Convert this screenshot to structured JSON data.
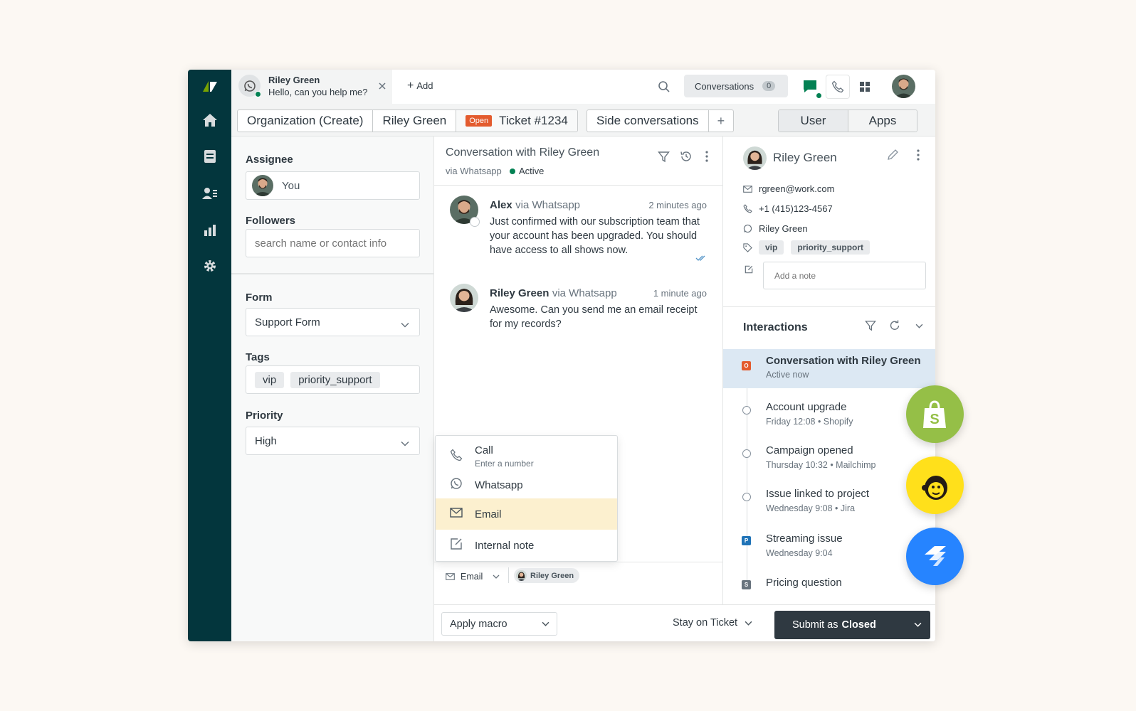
{
  "topbar": {
    "active_tab": {
      "name": "Riley Green",
      "preview": "Hello, can you help me?"
    },
    "add_label": "Add",
    "conversations_label": "Conversations",
    "conversations_count": "0"
  },
  "tabbar": {
    "organization": "Organization (Create)",
    "requester": "Riley Green",
    "status_badge": "Open",
    "ticket": "Ticket #1234",
    "side_conversations": "Side conversations",
    "user": "User",
    "apps": "Apps"
  },
  "properties": {
    "assignee_label": "Assignee",
    "assignee_value": "You",
    "followers_label": "Followers",
    "followers_placeholder": "search name or contact info",
    "form_label": "Form",
    "form_value": "Support Form",
    "tags_label": "Tags",
    "tags": [
      "vip",
      "priority_support"
    ],
    "priority_label": "Priority",
    "priority_value": "High"
  },
  "conversation": {
    "title": "Conversation with Riley Green",
    "via": "via Whatsapp",
    "status": "Active",
    "messages": [
      {
        "author": "Alex",
        "via": "via Whatsapp",
        "time": "2 minutes ago",
        "body": "Just confirmed with our subscription team that your account has been upgraded. You should have access to all shows now."
      },
      {
        "author": "Riley Green",
        "via": "via Whatsapp",
        "time": "1 minute ago",
        "body": "Awesome. Can you send me an email receipt for my records?"
      }
    ],
    "channel_menu": [
      {
        "label": "Call",
        "sub": "Enter a number",
        "icon": "phone-icon"
      },
      {
        "label": "Whatsapp",
        "icon": "whatsapp-icon"
      },
      {
        "label": "Email",
        "icon": "mail-icon",
        "highlighted": true
      },
      {
        "label": "Internal note",
        "icon": "note-icon"
      }
    ],
    "composer": {
      "channel": "Email",
      "recipient": "Riley Green"
    }
  },
  "footer": {
    "apply_macro": "Apply macro",
    "stay_on_ticket": "Stay on Ticket",
    "submit_prefix": "Submit as",
    "submit_status": "Closed"
  },
  "user": {
    "name": "Riley Green",
    "email": "rgreen@work.com",
    "phone": "+1 (415)123-4567",
    "whatsapp": "Riley Green",
    "tags": [
      "vip",
      "priority_support"
    ],
    "note_placeholder": "Add a note"
  },
  "interactions": {
    "title": "Interactions",
    "items": [
      {
        "title": "Conversation with Riley Green",
        "sub": "Active now",
        "marker": "O",
        "marker_color": "#e35b2e",
        "active": true
      },
      {
        "title": "Account upgrade",
        "sub": "Friday 12:08 • Shopify"
      },
      {
        "title": "Campaign opened",
        "sub": "Thursday 10:32 • Mailchimp"
      },
      {
        "title": "Issue linked to project",
        "sub": "Wednesday 9:08 • Jira"
      },
      {
        "title": "Streaming issue",
        "sub": "Wednesday 9:04",
        "marker": "P",
        "marker_color": "#1f73b7"
      },
      {
        "title": "Pricing question",
        "sub": "",
        "marker": "S",
        "marker_color": "#68737d"
      }
    ]
  },
  "colors": {
    "rail": "#03363d",
    "accent_green": "#038153",
    "open_badge": "#e35b2e",
    "highlight": "#fcf0cf",
    "active_row": "#dce8f3",
    "submit_bg": "#2f3941",
    "shopify": "#95bf47",
    "mailchimp": "#ffe01b",
    "jira": "#2684ff"
  }
}
